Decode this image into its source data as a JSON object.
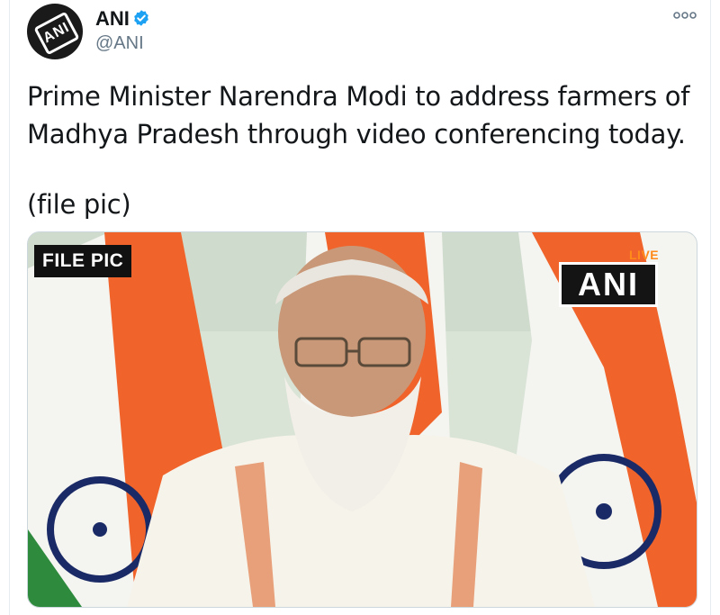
{
  "account": {
    "display_name": "ANI",
    "handle": "@ANI",
    "avatar_text": "ANI",
    "verified": true
  },
  "tweet": {
    "text": "Prime Minister Narendra Modi to address farmers of Madhya Pradesh through video conferencing today.",
    "note": "(file pic)"
  },
  "media": {
    "overlay_tag": "FILE PIC",
    "live_label": "LIVE",
    "channel_bug": "ANI"
  },
  "colors": {
    "text": "#14171a",
    "secondary_text": "#657786",
    "verified_blue": "#1da1f2",
    "saffron": "#f0642b",
    "india_green": "#2e8b3e",
    "chakra_blue": "#1a2a66"
  },
  "icons": [
    "verified-badge-icon",
    "more-options-icon"
  ]
}
